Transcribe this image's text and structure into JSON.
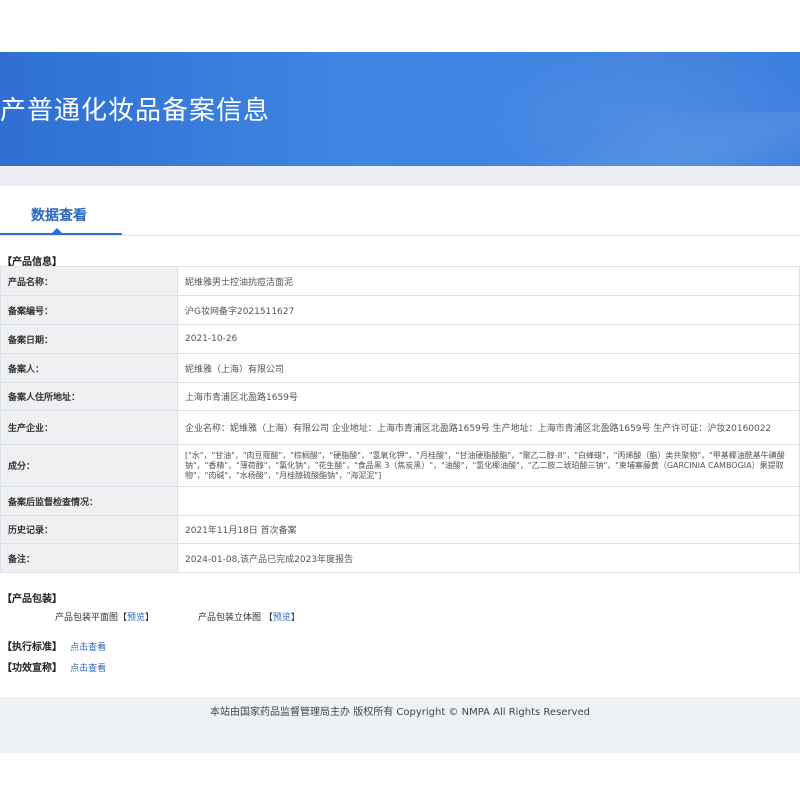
{
  "banner": {
    "title": "产普通化妆品备案信息"
  },
  "tabs": [
    {
      "label": "数据查看"
    }
  ],
  "product_section": {
    "title": "【产品信息】"
  },
  "rows": [
    {
      "label": "产品名称：",
      "value": "妮维雅男士控油抗痘洁面泥"
    },
    {
      "label": "备案编号：",
      "value": "沪G妆网备字2021511627"
    },
    {
      "label": "备案日期：",
      "value": "2021-10-26"
    },
    {
      "label": "备案人：",
      "value": "妮维雅（上海）有限公司"
    },
    {
      "label": "备案人住所地址：",
      "value": "上海市青浦区北盈路1659号"
    },
    {
      "label": "生产企业：",
      "value": "企业名称：妮维雅（上海）有限公司 企业地址：上海市青浦区北盈路1659号 生产地址：上海市青浦区北盈路1659号 生产许可证：沪妆20160022"
    },
    {
      "label": "成分：",
      "value": "[\"水\"，\"甘油\"，\"肉豆蔻酸\"，\"棕榈酸\"，\"硬脂酸\"，\"氢氧化钾\"，\"月桂酸\"，\"甘油硬脂酸酯\"，\"聚乙二醇-8\"，\"白蜂蜡\"，\"丙烯酸（酯）类共聚物\"，\"甲基椰油酰基牛磺酸钠\"，\"香精\"，\"薄荷醇\"，\"氯化钠\"，\"花生酸\"，\"食品黑 3（焦炭黑）\"，\"油酸\"，\"氢化椰油酸\"，\"乙二胺二琥珀酸三钠\"，\"柬埔寨藤黄（GARCINIA CAMBOGIA）果提取物\"，\"肉碱\"，\"水杨酸\"，\"月桂醇硫酸酯钠\"，\"海泥泥\"]"
    },
    {
      "label": "备案后监督检查情况：",
      "value": ""
    },
    {
      "label": "历史记录：",
      "value": "2021年11月18日 首次备案"
    },
    {
      "label": "备注：",
      "value": "2024-01-08,该产品已完成2023年度报告"
    }
  ],
  "package_section": {
    "title": "【产品包装】",
    "flat_label": "产品包装平面图",
    "stereo_label": "产品包装立体图",
    "preview_link": "预览",
    "bracket_open": "【",
    "bracket_close": "】"
  },
  "standard": {
    "title": "【执行标准】",
    "link": "点击查看"
  },
  "efficacy": {
    "title": "【功效宣称】",
    "link": "点击查看"
  },
  "footer": {
    "text": "本站由国家药品监督管理局主办 版权所有 Copyright © NMPA All Rights Reserved"
  }
}
